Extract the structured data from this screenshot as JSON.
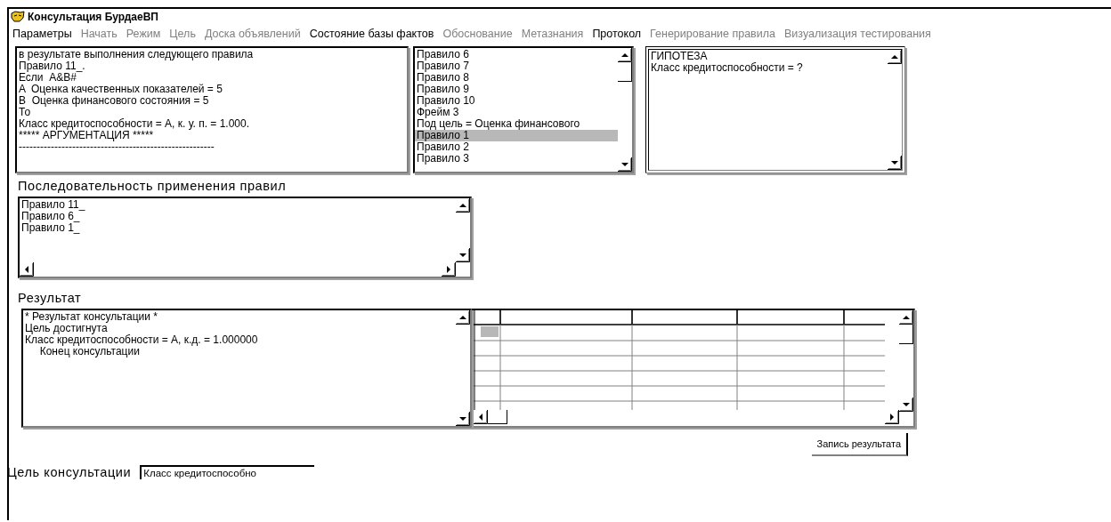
{
  "window": {
    "title": "Консультация БурдаеВП"
  },
  "menu": [
    {
      "label": "Параметры",
      "disabled": false
    },
    {
      "label": "Начать",
      "disabled": true
    },
    {
      "label": "Режим",
      "disabled": true
    },
    {
      "label": "Цель",
      "disabled": true
    },
    {
      "label": "Доска объявлений",
      "disabled": true
    },
    {
      "label": "Состояние базы фактов",
      "disabled": false
    },
    {
      "label": "Обоснование",
      "disabled": true
    },
    {
      "label": "Метазнания",
      "disabled": true
    },
    {
      "label": "Протокол",
      "disabled": false
    },
    {
      "label": "Генерирование правила",
      "disabled": true
    },
    {
      "label": "Визуализация тестирования",
      "disabled": true
    }
  ],
  "explanation": {
    "lines": [
      "в результате выполнения следующего правила",
      "Правило 11_.",
      "Если  A&B#",
      "A  Оценка качественных показателей = 5",
      "B  Оценка финансового состояния = 5",
      "То",
      "Класс кредитоспособности = А, к. у. п. = 1.000.",
      "***** АРГУМЕНТАЦИЯ *****",
      "-------------------------------------------------------"
    ]
  },
  "rules_list": {
    "items": [
      {
        "label": "Правило 6",
        "selected": false
      },
      {
        "label": "Правило 7",
        "selected": false
      },
      {
        "label": "Правило 8",
        "selected": false
      },
      {
        "label": "Правило 9",
        "selected": false
      },
      {
        "label": "Правило 10",
        "selected": false
      },
      {
        "label": "Фрейм  3",
        "selected": false
      },
      {
        "label": "Под цель = Оценка финансового",
        "selected": false
      },
      {
        "label": "Правило 1",
        "selected": true
      },
      {
        "label": "Правило 2",
        "selected": false
      },
      {
        "label": "Правило 3",
        "selected": false
      }
    ]
  },
  "hypothesis": {
    "lines": [
      "ГИПОТЕЗА",
      "Класс кредитоспособности = ?"
    ]
  },
  "sequence": {
    "label": "Последовательность применения правил",
    "lines": [
      "Правило 11_",
      "Правило 6_",
      "Правило 1_"
    ]
  },
  "result": {
    "label": "Результат",
    "lines": [
      "* Результат консультации *",
      "Цель достигнута",
      "Класс кредитоспособности = А, к.д. = 1.000000",
      "     Конец консультации"
    ]
  },
  "save_button": {
    "label": "Запись результата"
  },
  "goal": {
    "label": "Цель консультации",
    "value": "Класс кредитоспособно"
  }
}
